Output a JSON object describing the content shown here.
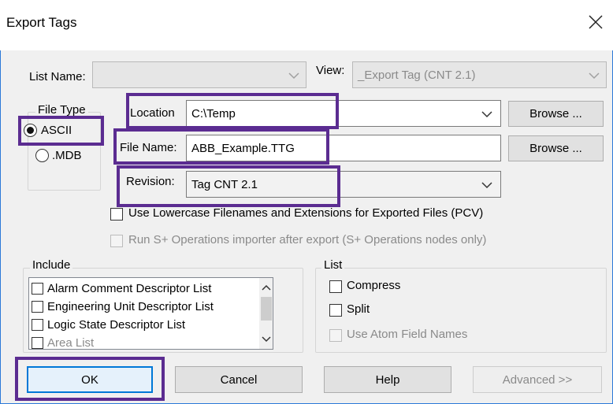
{
  "window": {
    "title": "Export Tags"
  },
  "top_row": {
    "list_name_label": "List Name:",
    "list_name_value": "",
    "view_label": "View:",
    "view_value": "_Export Tag (CNT 2.1)"
  },
  "file_type": {
    "group_title": "File Type",
    "options": [
      {
        "label": "ASCII",
        "selected": true
      },
      {
        "label": ".MDB",
        "selected": false
      }
    ]
  },
  "location": {
    "label": "Location",
    "value": "C:\\Temp",
    "browse_label": "Browse ..."
  },
  "file_name": {
    "label": "File Name:",
    "value": "ABB_Example.TTG",
    "browse_label": "Browse ..."
  },
  "revision": {
    "label": "Revision:",
    "value": "Tag CNT 2.1"
  },
  "options": {
    "lowercase_label": "Use Lowercase Filenames and Extensions for Exported Files (PCV)",
    "lowercase_checked": false,
    "run_importer_label": "Run S+ Operations importer after export (S+ Operations nodes only)",
    "run_importer_checked": false
  },
  "include": {
    "group_title": "Include",
    "items": [
      {
        "label": "Alarm Comment Descriptor List",
        "checked": false
      },
      {
        "label": "Engineering Unit Descriptor List",
        "checked": false
      },
      {
        "label": "Logic State Descriptor List",
        "checked": false
      },
      {
        "label": "Area List",
        "checked": false
      }
    ]
  },
  "list_group": {
    "group_title": "List",
    "compress_label": "Compress",
    "compress_checked": false,
    "split_label": "Split",
    "split_checked": false,
    "atom_label": "Use Atom Field Names",
    "atom_checked": false
  },
  "buttons": {
    "ok": "OK",
    "cancel": "Cancel",
    "help": "Help",
    "advanced": "Advanced >>"
  },
  "colors": {
    "highlight_box": "#5b2c91",
    "window_border": "#2b79d8",
    "default_button_border": "#0078d7"
  }
}
